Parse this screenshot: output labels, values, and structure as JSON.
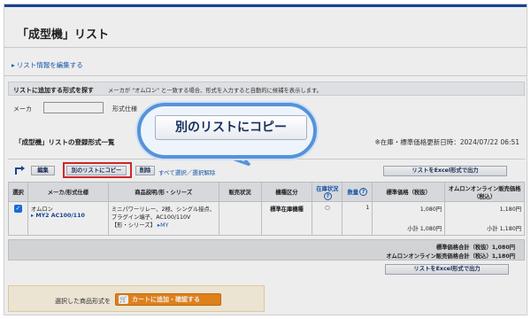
{
  "page": {
    "title": "「成型機」リスト",
    "edit_link": "リスト情報を編集する"
  },
  "search": {
    "title": "リストに追加する形式を探す",
    "hint": "メーカが \"オムロン\" と一致する場合、形式を入力すると自動的に候補を表示します。",
    "maker_label": "メーカ",
    "maker_value": "",
    "spec_label": "形式仕様"
  },
  "list": {
    "heading": "「成型機」リストの登録形式一覧",
    "update_info": "※在庫・標準価格更新日時：2024/07/22 06:51"
  },
  "toolbar": {
    "edit": "編集",
    "copy": "別のリストにコピー",
    "delete": "削除",
    "select_all": "すべて選択／選択解除",
    "excel": "リストをExcel形式で出力"
  },
  "table": {
    "headers": {
      "select": "選択",
      "maker": "メーカ/形式仕様",
      "desc": "商品説明/形・シリーズ",
      "status": "販売状況",
      "category": "機種区分",
      "stock": "在庫状況",
      "qty": "数量",
      "std_price": "標準価格（税抜）",
      "online_price": "オムロンオンライン販売価格（税込）",
      "help_symbol": "?"
    },
    "rows": [
      {
        "checked": "✓",
        "maker": "オムロン",
        "model": "MY2 AC100/110",
        "model_arrow": "▸",
        "desc_line1": "ミニパワーリレー、2極、シングル接点、",
        "desc_line2": "プラグイン端子、AC100/110V",
        "desc_series": "【形・シリーズ】",
        "series_link": "MY",
        "series_arrow": "▸",
        "status": "",
        "category": "標準在庫機種",
        "stock": "○",
        "qty": "1",
        "std_price": "1,080円",
        "std_subtotal": "小計 1,080円",
        "online_price": "1,180円",
        "online_subtotal": "小計 1,180円"
      }
    ]
  },
  "totals": {
    "std_total": "標準価格合計（税抜）1,080円",
    "online_total": "オムロンオンライン販売価格合計（税込）1,180円"
  },
  "bottom": {
    "excel": "リストをExcel形式で出力"
  },
  "cart": {
    "label": "選択した商品形式を",
    "button": "カートに追加・確認する",
    "icon_glyph": "🛒"
  },
  "callout": {
    "label": "別のリストにコピー"
  },
  "colors": {
    "accent": "#1a4a9c",
    "link": "#1a5db5",
    "highlight": "#e0282e",
    "callout": "#5593d9",
    "cart": "#f08a1c",
    "stock_green": "#20883a"
  }
}
